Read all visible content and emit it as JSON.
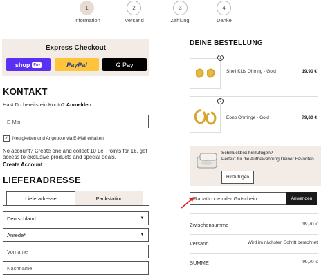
{
  "stepper": {
    "steps": [
      {
        "num": "1",
        "label": "Information"
      },
      {
        "num": "2",
        "label": "Versand"
      },
      {
        "num": "3",
        "label": "Zahlung"
      },
      {
        "num": "4",
        "label": "Danke"
      }
    ]
  },
  "express": {
    "title": "Express Checkout",
    "shop_pay": "shop",
    "shop_pay_badge": "Pay",
    "paypal": "PayPal",
    "gpay": "G Pay"
  },
  "contact": {
    "heading": "KONTAKT",
    "account_prompt": "Hast Du bereits ein Konto?",
    "login_link": "Anmelden",
    "email_placeholder": "E-Mail",
    "newsletter_label": "Neuigkeiten und Angebote via E-Mail erhalten",
    "newsletter_checked": true,
    "checkmark": "✓",
    "points_text": "No account? Create one and collect 10 Lei Points for 1€, get access to exclusive products and special deals.",
    "create_account": "Create Account"
  },
  "delivery": {
    "heading": "LIEFERADRESSE",
    "tabs": [
      "Lieferadresse",
      "Packstation"
    ],
    "country": "Deutschland",
    "salutation": "Anrede*",
    "firstname_placeholder": "Vorname",
    "lastname_placeholder": "Nachname",
    "arrow": "▼"
  },
  "order": {
    "heading": "DEINE BESTELLUNG",
    "items": [
      {
        "qty": "1",
        "name": "Shell Kids Ohrring",
        "variant": "Gold",
        "price": "19,90 €"
      },
      {
        "qty": "2",
        "name": "Eono Ohrringe",
        "variant": "Gold",
        "price": "79,80 €"
      }
    ],
    "separator": "·",
    "upsell_title": "Schmuckbox hinzufügen?",
    "upsell_text": "Perfekt für die Aufbewahrung Deiner Favoriten.",
    "upsell_button": "Hinzufügen",
    "discount_placeholder": "Rabattcode oder Gutschein",
    "apply_button": "Anwenden",
    "subtotal_label": "Zwischensumme",
    "subtotal_value": "99,70 €",
    "shipping_label": "Versand",
    "shipping_value": "Wird im nächsten Schritt berechnet",
    "total_label": "SUMME",
    "total_value": "99,70 €"
  },
  "colors": {
    "accent_bg": "#f3ece6",
    "annotation_arrow": "#e02020"
  }
}
